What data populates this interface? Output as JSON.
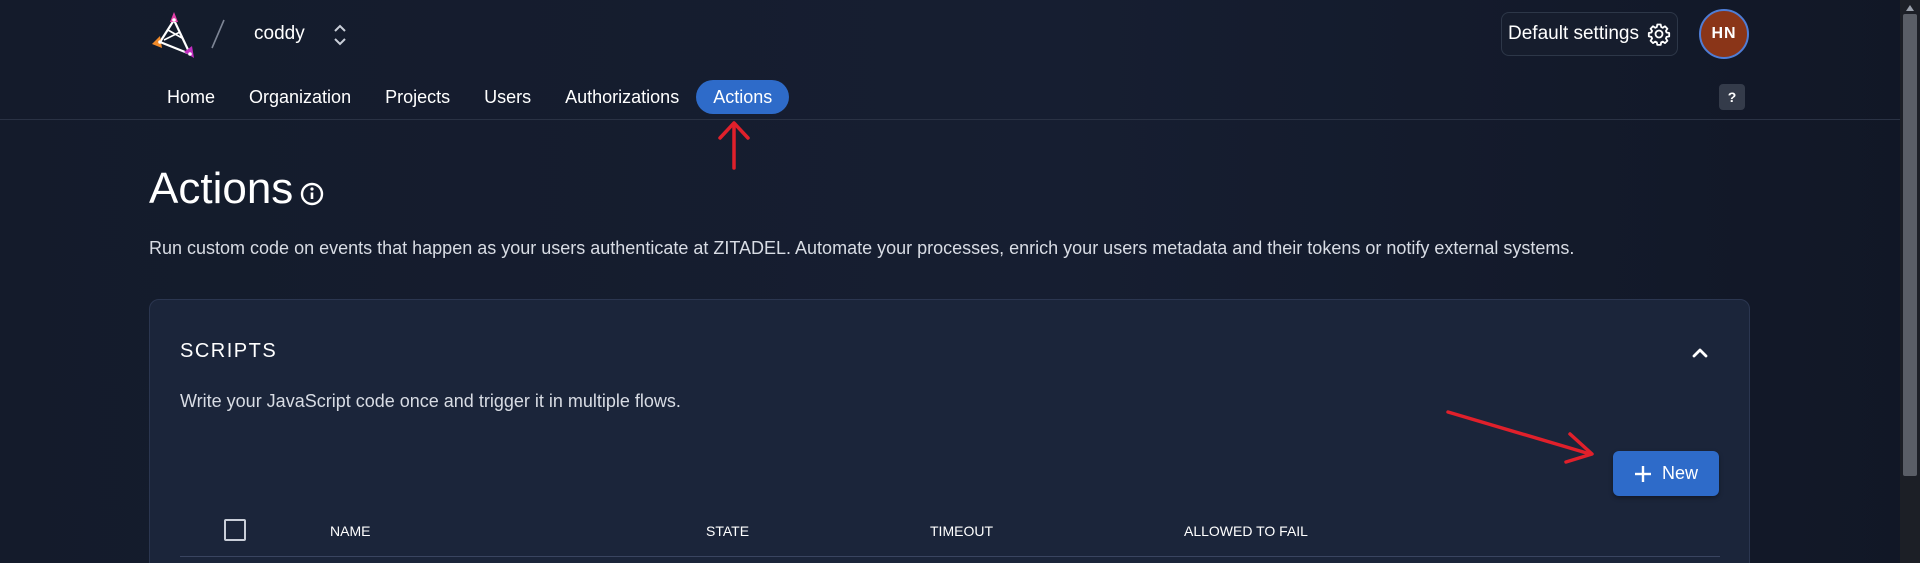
{
  "header": {
    "org_name": "coddy",
    "default_settings_label": "Default settings",
    "avatar_initials": "HN",
    "help_label": "?"
  },
  "nav": {
    "items": [
      {
        "label": "Home"
      },
      {
        "label": "Organization"
      },
      {
        "label": "Projects"
      },
      {
        "label": "Users"
      },
      {
        "label": "Authorizations"
      },
      {
        "label": "Actions",
        "active": true
      }
    ]
  },
  "page": {
    "title": "Actions",
    "description": "Run custom code on events that happen as your users authenticate at ZITADEL. Automate your processes, enrich your users metadata and their tokens or notify external systems."
  },
  "scripts_card": {
    "title": "SCRIPTS",
    "description": "Write your JavaScript code once and trigger it in multiple flows.",
    "new_button_label": "New",
    "columns": [
      "NAME",
      "STATE",
      "TIMEOUT",
      "ALLOWED TO FAIL"
    ]
  },
  "colors": {
    "accent": "#2e6bc9",
    "annotation_arrow": "#e0202b",
    "avatar_bg": "#8a3518"
  },
  "icons": {
    "logo": "zitadel-logo",
    "org_switch": "chevron-up-down-icon",
    "settings": "gear-icon",
    "info": "info-icon",
    "collapse": "chevron-up-icon",
    "new": "plus-icon"
  }
}
